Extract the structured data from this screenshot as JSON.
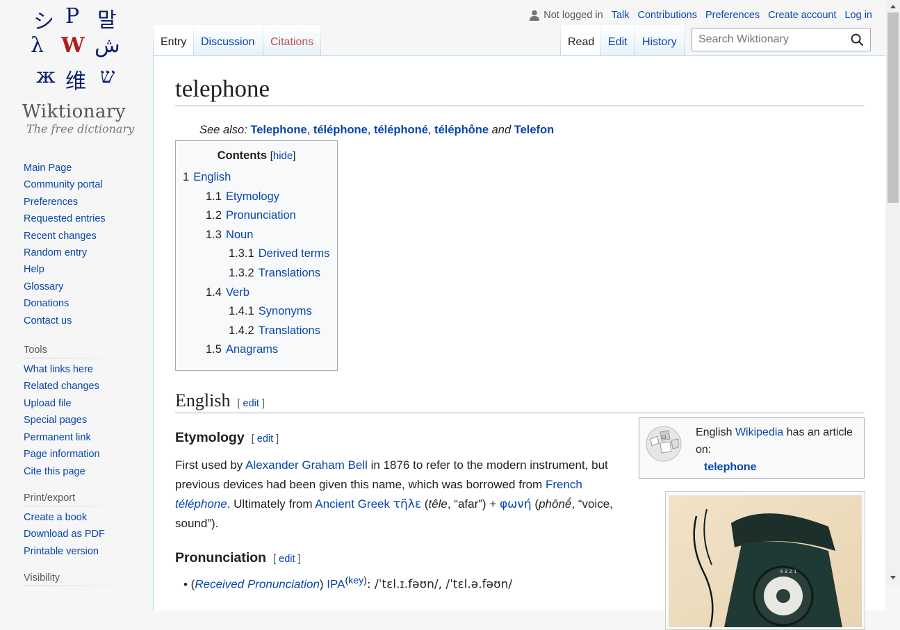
{
  "logo": {
    "wordmark": "Wiktionary",
    "tagline": "The free dictionary"
  },
  "nav": {
    "main": [
      "Main Page",
      "Community portal",
      "Preferences",
      "Requested entries",
      "Recent changes",
      "Random entry",
      "Help",
      "Glossary",
      "Donations",
      "Contact us"
    ],
    "tools_heading": "Tools",
    "tools": [
      "What links here",
      "Related changes",
      "Upload file",
      "Special pages",
      "Permanent link",
      "Page information",
      "Cite this page"
    ],
    "print_heading": "Print/export",
    "print": [
      "Create a book",
      "Download as PDF",
      "Printable version"
    ],
    "partial_heading": "Visibility"
  },
  "personal": {
    "status": "Not logged in",
    "links": [
      "Talk",
      "Contributions",
      "Preferences",
      "Create account",
      "Log in"
    ]
  },
  "tabs": {
    "entry": "Entry",
    "discussion": "Discussion",
    "citations": "Citations",
    "read": "Read",
    "edit": "Edit",
    "history": "History"
  },
  "search": {
    "placeholder": "Search Wiktionary"
  },
  "page": {
    "title": "telephone",
    "see_also_label": "See also:",
    "see_also": [
      "Telephone",
      "téléphone",
      "téléphoné",
      "téléphône",
      "Telefon"
    ],
    "see_also_and": "and"
  },
  "toc": {
    "title": "Contents",
    "hide": "hide",
    "items": [
      {
        "num": "1",
        "label": "English",
        "level": 1
      },
      {
        "num": "1.1",
        "label": "Etymology",
        "level": 2
      },
      {
        "num": "1.2",
        "label": "Pronunciation",
        "level": 2
      },
      {
        "num": "1.3",
        "label": "Noun",
        "level": 2
      },
      {
        "num": "1.3.1",
        "label": "Derived terms",
        "level": 3
      },
      {
        "num": "1.3.2",
        "label": "Translations",
        "level": 3
      },
      {
        "num": "1.4",
        "label": "Verb",
        "level": 2
      },
      {
        "num": "1.4.1",
        "label": "Synonyms",
        "level": 3
      },
      {
        "num": "1.4.2",
        "label": "Translations",
        "level": 3
      },
      {
        "num": "1.5",
        "label": "Anagrams",
        "level": 2
      }
    ]
  },
  "sections": {
    "english": "English",
    "etymology": "Etymology",
    "pronunciation": "Pronunciation",
    "edit": "edit"
  },
  "wikipedia_box": {
    "pre": "English",
    "link": "Wikipedia",
    "post": "has an article on:",
    "article": "telephone"
  },
  "etymology": {
    "t1": "First used by",
    "l1": "Alexander Graham Bell",
    "t2": "in 1876 to refer to the modern instrument, but previous devices had been given this name, which was borrowed from",
    "l2": "French",
    "l3": "téléphone",
    "t3": ". Ultimately from",
    "l4": "Ancient Greek",
    "l5": "τῆλε",
    "t4": "(",
    "tr1": "têle",
    "t5": ", “afar”) +",
    "l6": "φωνή",
    "t6": "(",
    "tr2": "phōnḗ",
    "t7": ", “voice, sound”)."
  },
  "pronunciation": {
    "region": "Received Pronunciation",
    "ipa": "IPA",
    "key": "key",
    "text": ": /ˈtɛl.ɪ.fəʊn/, /ˈtɛl.ə.fəʊn/"
  }
}
